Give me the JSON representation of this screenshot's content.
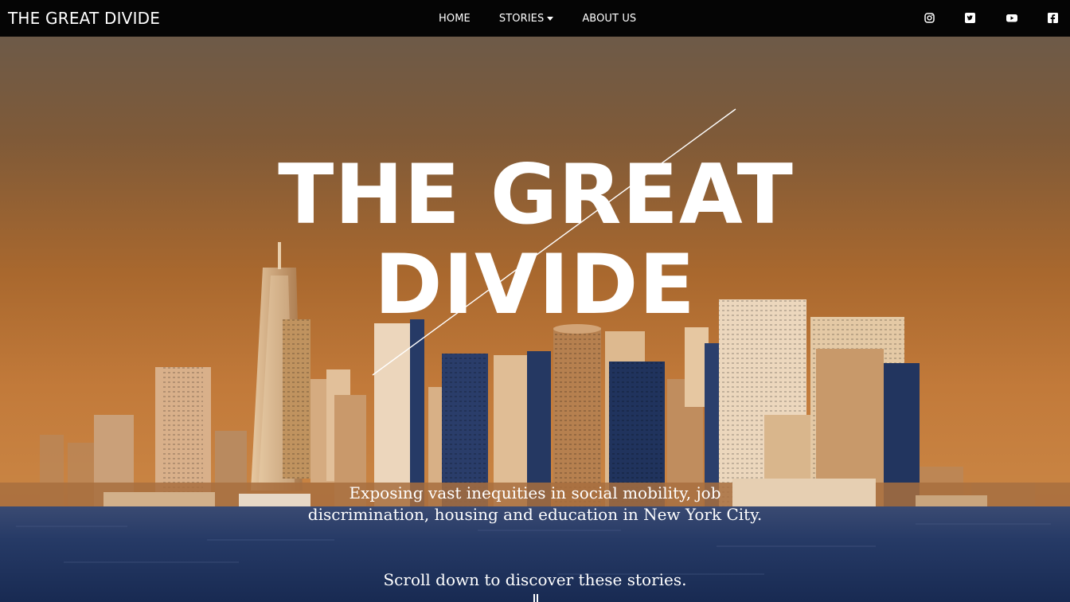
{
  "navbar": {
    "brand": "THE GREAT DIVIDE",
    "links": {
      "home": "HOME",
      "stories": "STORIES",
      "about": "ABOUT US"
    },
    "social": [
      "instagram-icon",
      "twitter-icon",
      "youtube-icon",
      "facebook-icon"
    ]
  },
  "hero": {
    "title_line1": "THE GREAT",
    "title_line2": "DIVIDE",
    "subtitle_line1": "Exposing vast inequities in social mobility, job",
    "subtitle_line2": "discrimination, housing and education in New York City.",
    "scroll_cta": "Scroll down to discover these stories."
  },
  "colors": {
    "navbar_bg": "#050505",
    "sky_tint": "#c27a3a",
    "building_blue": "#1e2f55",
    "water_blue": "#23355f",
    "text": "#ffffff"
  }
}
